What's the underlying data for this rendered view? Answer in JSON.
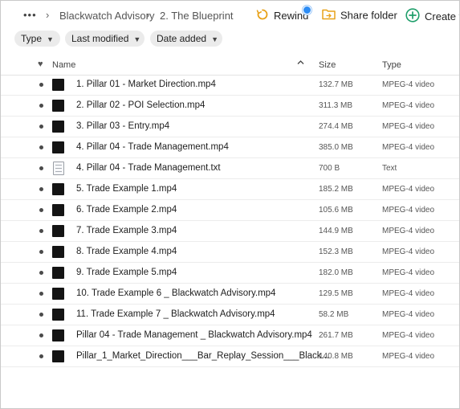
{
  "breadcrumb": {
    "more": "•••",
    "root": "Blackwatch Advisory",
    "separator": "›",
    "current": "2. The Blueprint"
  },
  "toolbar": {
    "rewind": "Rewind",
    "share": "Share folder",
    "create": "Create fo",
    "accent": "#2c8cf4",
    "share_icon_color": "#e8a21a",
    "create_icon_color": "#1e9e6a",
    "rewind_icon_color": "#e8a21a"
  },
  "filters": {
    "type": "Type",
    "modified": "Last modified",
    "added": "Date added"
  },
  "columns": {
    "name": "Name",
    "size": "Size",
    "type": "Type"
  },
  "files": [
    {
      "name": "1. Pillar 01 - Market Direction.mp4",
      "size": "132.7 MB",
      "type": "MPEG-4 video",
      "kind": "video"
    },
    {
      "name": "2. Pillar 02 - POI Selection.mp4",
      "size": "311.3 MB",
      "type": "MPEG-4 video",
      "kind": "video"
    },
    {
      "name": "3. Pillar 03 - Entry.mp4",
      "size": "274.4 MB",
      "type": "MPEG-4 video",
      "kind": "video"
    },
    {
      "name": "4. Pillar 04 - Trade Management.mp4",
      "size": "385.0 MB",
      "type": "MPEG-4 video",
      "kind": "video"
    },
    {
      "name": "4. Pillar 04 - Trade Management.txt",
      "size": "700 B",
      "type": "Text",
      "kind": "text"
    },
    {
      "name": "5. Trade Example 1.mp4",
      "size": "185.2 MB",
      "type": "MPEG-4 video",
      "kind": "video"
    },
    {
      "name": "6. Trade Example 2.mp4",
      "size": "105.6 MB",
      "type": "MPEG-4 video",
      "kind": "video"
    },
    {
      "name": "7. Trade Example 3.mp4",
      "size": "144.9 MB",
      "type": "MPEG-4 video",
      "kind": "video"
    },
    {
      "name": "8. Trade Example 4.mp4",
      "size": "152.3 MB",
      "type": "MPEG-4 video",
      "kind": "video"
    },
    {
      "name": "9. Trade Example 5.mp4",
      "size": "182.0 MB",
      "type": "MPEG-4 video",
      "kind": "video"
    },
    {
      "name": "10. Trade Example 6 _ Blackwatch Advisory.mp4",
      "size": "129.5 MB",
      "type": "MPEG-4 video",
      "kind": "video"
    },
    {
      "name": "11. Trade Example 7 _ Blackwatch Advisory.mp4",
      "size": "58.2 MB",
      "type": "MPEG-4 video",
      "kind": "video"
    },
    {
      "name": "Pillar 04 - Trade Management _ Blackwatch Advisory.mp4",
      "size": "261.7 MB",
      "type": "MPEG-4 video",
      "kind": "video"
    },
    {
      "name": "Pillar_1_Market_Direction___Bar_Replay_Session___Black...",
      "size": "140.8 MB",
      "type": "MPEG-4 video",
      "kind": "video"
    }
  ]
}
